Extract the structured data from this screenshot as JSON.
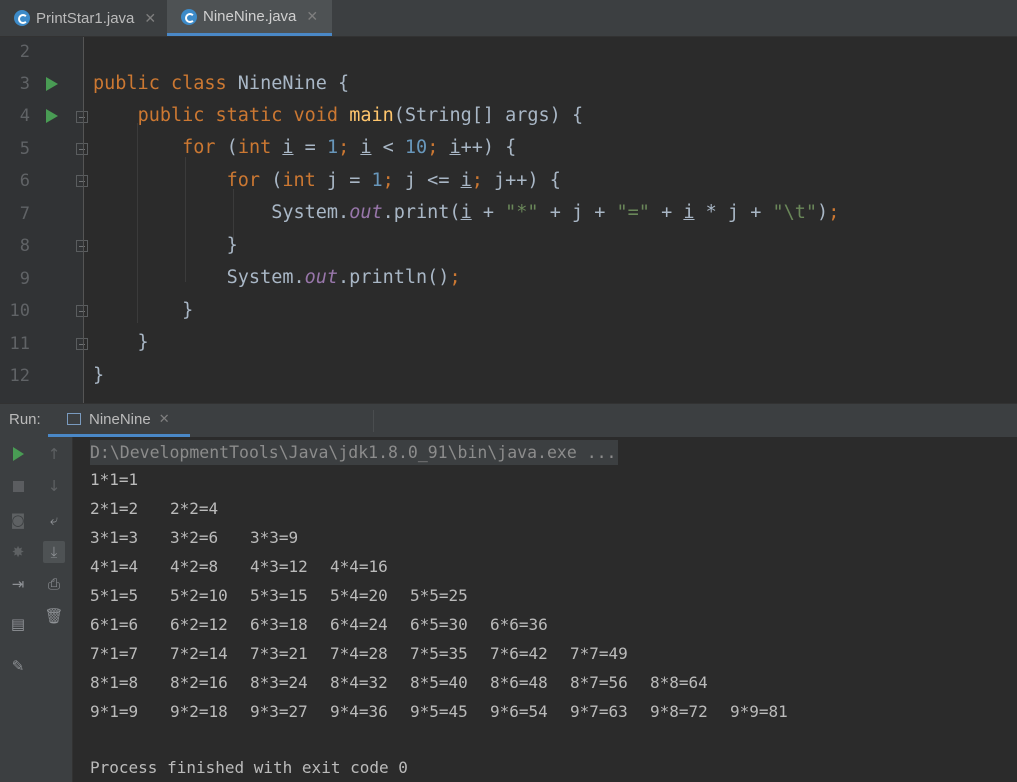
{
  "tabs": [
    {
      "label": "PrintStar1.java",
      "active": false
    },
    {
      "label": "NineNine.java",
      "active": true
    }
  ],
  "editor": {
    "line_numbers": [
      "2",
      "3",
      "4",
      "5",
      "6",
      "7",
      "8",
      "9",
      "10",
      "11",
      "12"
    ]
  },
  "run_panel": {
    "label": "Run:",
    "tab_label": "NineNine"
  },
  "console": {
    "command": "D:\\DevelopmentTools\\Java\\jdk1.8.0_91\\bin\\java.exe ...",
    "rows": [
      [
        "1*1=1"
      ],
      [
        "2*1=2",
        "2*2=4"
      ],
      [
        "3*1=3",
        "3*2=6",
        "3*3=9"
      ],
      [
        "4*1=4",
        "4*2=8",
        "4*3=12",
        "4*4=16"
      ],
      [
        "5*1=5",
        "5*2=10",
        "5*3=15",
        "5*4=20",
        "5*5=25"
      ],
      [
        "6*1=6",
        "6*2=12",
        "6*3=18",
        "6*4=24",
        "6*5=30",
        "6*6=36"
      ],
      [
        "7*1=7",
        "7*2=14",
        "7*3=21",
        "7*4=28",
        "7*5=35",
        "7*6=42",
        "7*7=49"
      ],
      [
        "8*1=8",
        "8*2=16",
        "8*3=24",
        "8*4=32",
        "8*5=40",
        "8*6=48",
        "8*7=56",
        "8*8=64"
      ],
      [
        "9*1=9",
        "9*2=18",
        "9*3=27",
        "9*4=36",
        "9*5=45",
        "9*6=54",
        "9*7=63",
        "9*8=72",
        "9*9=81"
      ]
    ],
    "finish": "Process finished with exit code 0"
  },
  "colors": {
    "keyword": "#cc7832",
    "number": "#6897bb",
    "string": "#6a8759",
    "method": "#ffc66d",
    "field": "#9876aa",
    "accent": "#4a88c7",
    "run_green": "#499c54"
  }
}
